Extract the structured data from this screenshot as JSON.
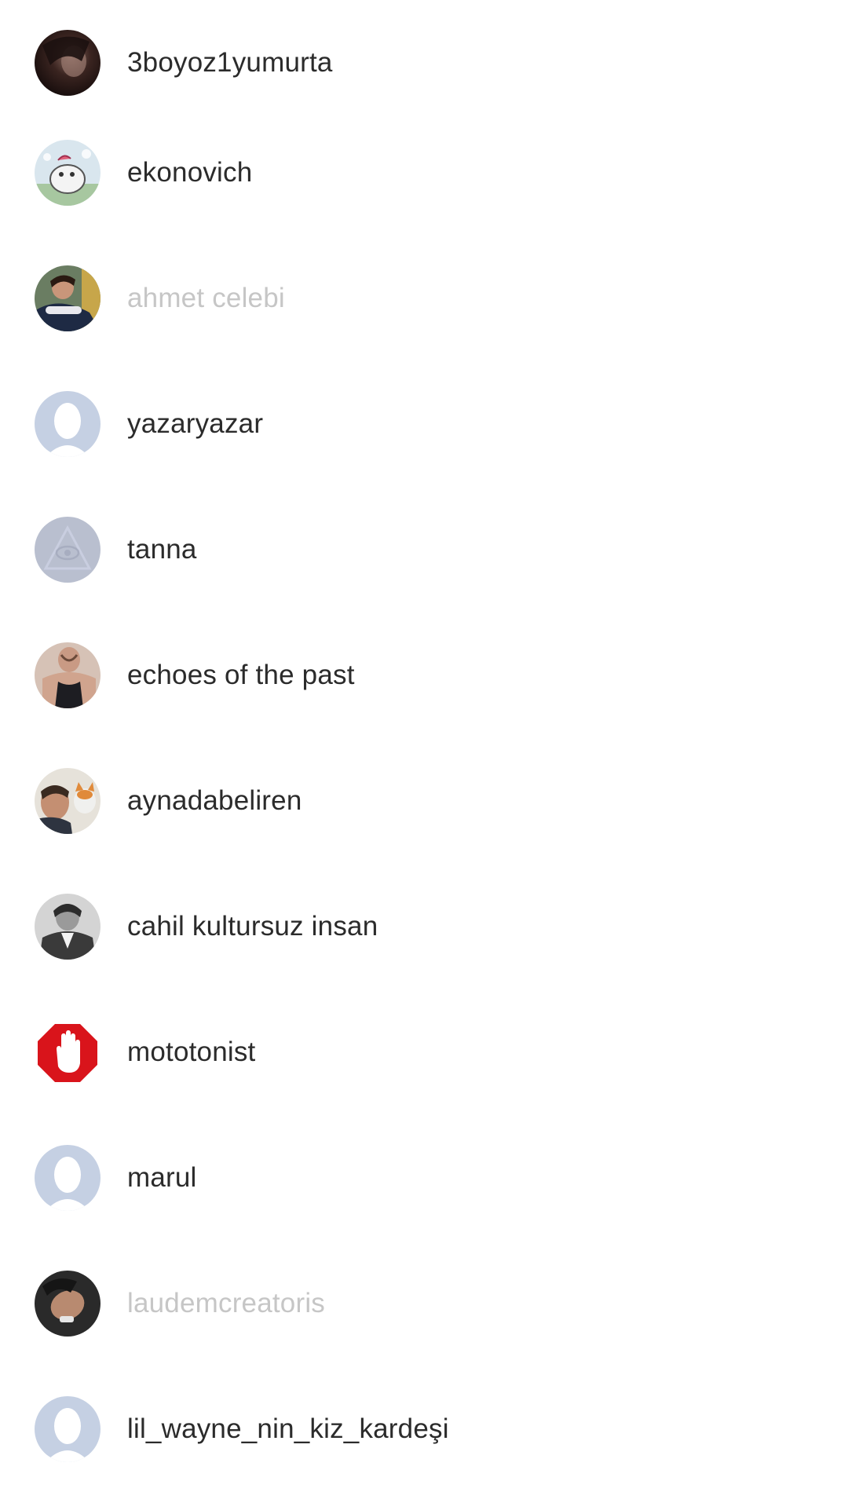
{
  "users": [
    {
      "name": "3boyoz1yumurta",
      "avatar": "photo-dark-hooded-avatar",
      "dimmed": false
    },
    {
      "name": "ekonovich",
      "avatar": "cartoon-cat-avatar",
      "dimmed": false
    },
    {
      "name": "ahmet celebi",
      "avatar": "photo-man-avatar",
      "dimmed": true
    },
    {
      "name": "yazaryazar",
      "avatar": "default-person-avatar",
      "dimmed": false
    },
    {
      "name": "tanna",
      "avatar": "eye-pyramid-avatar",
      "dimmed": false
    },
    {
      "name": "echoes of the past",
      "avatar": "photo-man-tanktop-avatar",
      "dimmed": false
    },
    {
      "name": "aynadabeliren",
      "avatar": "photo-man-with-cat-avatar",
      "dimmed": false
    },
    {
      "name": "cahil kultursuz insan",
      "avatar": "photo-bw-portrait-avatar",
      "dimmed": false
    },
    {
      "name": "mototonist",
      "avatar": "stop-hand-icon",
      "dimmed": false
    },
    {
      "name": "marul",
      "avatar": "default-person-avatar",
      "dimmed": false
    },
    {
      "name": "laudemcreatoris",
      "avatar": "photo-man-tilted-avatar",
      "dimmed": true
    },
    {
      "name": "lil_wayne_nin_kiz_kardeşi",
      "avatar": "default-person-avatar",
      "dimmed": false
    }
  ],
  "colors": {
    "text": "#2b2b2b",
    "text_dimmed": "#c6c6c6",
    "default_avatar": "#c5d0e3",
    "stop_red": "#d9141b"
  }
}
